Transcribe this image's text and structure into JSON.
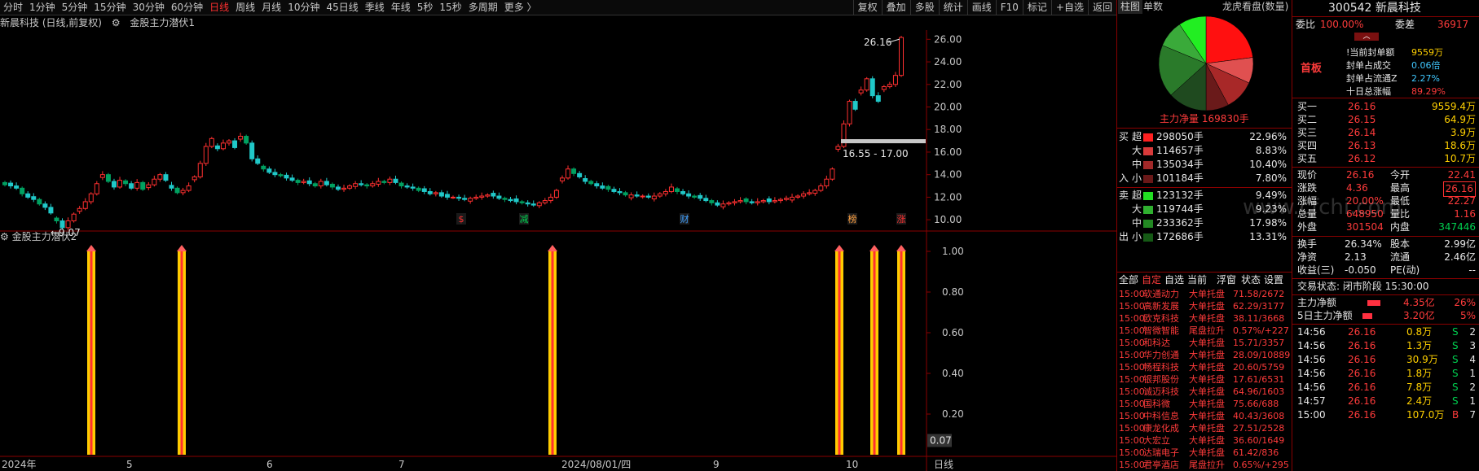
{
  "toolbar": {
    "timeframes": [
      "分时",
      "1分钟",
      "5分钟",
      "15分钟",
      "30分钟",
      "60分钟",
      "日线",
      "周线",
      "月线",
      "10分钟",
      "45日线",
      "季线",
      "年线",
      "5秒",
      "15秒",
      "多周期",
      "更多 〉"
    ],
    "active_index": 6,
    "right_buttons": [
      "复权",
      "叠加",
      "多股",
      "统计",
      "画线",
      "F10",
      "标记",
      "+自选",
      "返回"
    ]
  },
  "chart": {
    "title": "新晨科技 (日线,前复权)",
    "indicator": "金股主力潜伏1",
    "high_label": "26.16",
    "low_label": "9.07",
    "range_label": "16.55 - 17.00",
    "y_ticks": [
      "26.00",
      "24.00",
      "22.00",
      "20.00",
      "18.00",
      "16.00",
      "14.00",
      "12.00",
      "10.00"
    ],
    "markers": [
      "$",
      "减",
      "财",
      "榜",
      "涨"
    ],
    "x_ticks": [
      "2024年",
      "5",
      "6",
      "7",
      "2024/08/01/四",
      "9",
      "10"
    ]
  },
  "sub_chart": {
    "title": "金股主力潜伏2",
    "y_ticks": [
      "1.00",
      "0.80",
      "0.60",
      "0.40",
      "0.20"
    ],
    "value_label": "0.07",
    "period_label": "日线"
  },
  "mid_panel": {
    "tabs": [
      "柱图",
      "单数"
    ],
    "pie_title": "龙虎看盘(数量)",
    "net_label": "主力净量 169830手",
    "buy": {
      "side": "买",
      "in_label": "入",
      "rows": [
        {
          "label": "超",
          "value": "298050手",
          "pct": "22.96%",
          "color": "#ff2020"
        },
        {
          "label": "大",
          "value": "114657手",
          "pct": "8.83%",
          "color": "#d83a3a"
        },
        {
          "label": "中",
          "value": "135034手",
          "pct": "10.40%",
          "color": "#a02828"
        },
        {
          "label": "小",
          "value": "101184手",
          "pct": "7.80%",
          "color": "#6a1818"
        }
      ]
    },
    "sell": {
      "side": "卖",
      "out_label": "出",
      "rows": [
        {
          "label": "超",
          "value": "123132手",
          "pct": "9.49%",
          "color": "#22dd22"
        },
        {
          "label": "大",
          "value": "119744手",
          "pct": "9.23%",
          "color": "#2fb02f"
        },
        {
          "label": "中",
          "value": "233362手",
          "pct": "17.98%",
          "color": "#228822"
        },
        {
          "label": "小",
          "value": "172686手",
          "pct": "13.31%",
          "color": "#155a15"
        }
      ]
    },
    "list_tabs": [
      "全部",
      "自定",
      "自选",
      "当前",
      "浮窗",
      "状态",
      "设置"
    ],
    "list_active": 1,
    "list": [
      {
        "t": "15:00",
        "n": "软通动力",
        "a": "大单托盘",
        "v": "71.58/2672"
      },
      {
        "t": "15:00",
        "n": "高新发展",
        "a": "大单托盘",
        "v": "62.29/3177"
      },
      {
        "t": "15:00",
        "n": "欧克科技",
        "a": "大单托盘",
        "v": "38.11/3668"
      },
      {
        "t": "15:00",
        "n": "智微智能",
        "a": "尾盘拉升",
        "v": "0.57%/+227"
      },
      {
        "t": "15:00",
        "n": "和科达",
        "a": "大单托盘",
        "v": "15.71/3357"
      },
      {
        "t": "15:00",
        "n": "华力创通",
        "a": "大单托盘",
        "v": "28.09/10889"
      },
      {
        "t": "15:00",
        "n": "畅程科技",
        "a": "大单托盘",
        "v": "20.60/5759"
      },
      {
        "t": "15:00",
        "n": "银邦股份",
        "a": "大单托盘",
        "v": "17.61/6531"
      },
      {
        "t": "15:00",
        "n": "诚迈科技",
        "a": "大单托盘",
        "v": "64.96/1603"
      },
      {
        "t": "15:00",
        "n": "国科微",
        "a": "大单托盘",
        "v": "75.66/688"
      },
      {
        "t": "15:00",
        "n": "中科信息",
        "a": "大单托盘",
        "v": "40.43/3608"
      },
      {
        "t": "15:00",
        "n": "康龙化成",
        "a": "大单托盘",
        "v": "27.51/2528"
      },
      {
        "t": "15:00",
        "n": "大宏立",
        "a": "大单托盘",
        "v": "36.60/1649"
      },
      {
        "t": "15:00",
        "n": "达瑞电子",
        "a": "大单托盘",
        "v": "61.42/836"
      },
      {
        "t": "15:00",
        "n": "君亭酒店",
        "a": "尾盘拉升",
        "v": "0.65%/+295"
      }
    ]
  },
  "quote": {
    "code_name": "300542 新晨科技",
    "ratio_label": "委比",
    "ratio": "100.00%",
    "diff_label": "委差",
    "diff": "36917",
    "board_label": "首板",
    "seal": [
      {
        "k": "!当前封单额",
        "v": "9559万"
      },
      {
        "k": "封单占成交",
        "v": "0.06倍"
      },
      {
        "k": "封单占流通Z",
        "v": "2.27%"
      },
      {
        "k": "十日总涨幅",
        "v": "89.29%"
      }
    ],
    "bids": [
      {
        "k": "买一",
        "p": "26.16",
        "v": "9559.4万"
      },
      {
        "k": "买二",
        "p": "26.15",
        "v": "64.9万"
      },
      {
        "k": "买三",
        "p": "26.14",
        "v": "3.9万"
      },
      {
        "k": "买四",
        "p": "26.13",
        "v": "18.6万"
      },
      {
        "k": "买五",
        "p": "26.12",
        "v": "10.7万"
      }
    ],
    "stats_left": [
      {
        "k": "现价",
        "v": "26.16"
      },
      {
        "k": "涨跌",
        "v": "4.36"
      },
      {
        "k": "涨幅",
        "v": "20.00%"
      },
      {
        "k": "总量",
        "v": "648950"
      },
      {
        "k": "外盘",
        "v": "301504"
      }
    ],
    "stats_right": [
      {
        "k": "今开",
        "v": "22.41"
      },
      {
        "k": "最高",
        "v": "26.16"
      },
      {
        "k": "最低",
        "v": "22.27"
      },
      {
        "k": "量比",
        "v": "1.16"
      },
      {
        "k": "内盘",
        "v": "347446"
      }
    ],
    "fund": [
      {
        "k1": "换手",
        "v1": "26.34%",
        "k2": "股本",
        "v2": "2.99亿"
      },
      {
        "k1": "净资",
        "v1": "2.13",
        "k2": "流通",
        "v2": "2.46亿"
      },
      {
        "k1": "收益(三)",
        "v1": "-0.050",
        "k2": "PE(动)",
        "v2": "--"
      }
    ],
    "trade_status": "交易状态: 闭市阶段 15:30:00",
    "flows": [
      {
        "k": "主力净额",
        "v": "4.35亿",
        "pct": "26%"
      },
      {
        "k": "5日主力净额",
        "v": "3.20亿",
        "pct": "5%"
      }
    ],
    "ticks": [
      {
        "t": "14:56",
        "p": "26.16",
        "v": "0.8万",
        "s": "S",
        "n": "2"
      },
      {
        "t": "14:56",
        "p": "26.16",
        "v": "1.3万",
        "s": "S",
        "n": "3"
      },
      {
        "t": "14:56",
        "p": "26.16",
        "v": "30.9万",
        "s": "S",
        "n": "4"
      },
      {
        "t": "14:56",
        "p": "26.16",
        "v": "1.8万",
        "s": "S",
        "n": "1"
      },
      {
        "t": "14:56",
        "p": "26.16",
        "v": "7.8万",
        "s": "S",
        "n": "2"
      },
      {
        "t": "14:57",
        "p": "26.16",
        "v": "2.4万",
        "s": "S",
        "n": "1"
      },
      {
        "t": "15:00",
        "p": "26.16",
        "v": "107.0万",
        "s": "B",
        "n": "7"
      }
    ]
  },
  "watermark": "www.cfchi.com"
}
